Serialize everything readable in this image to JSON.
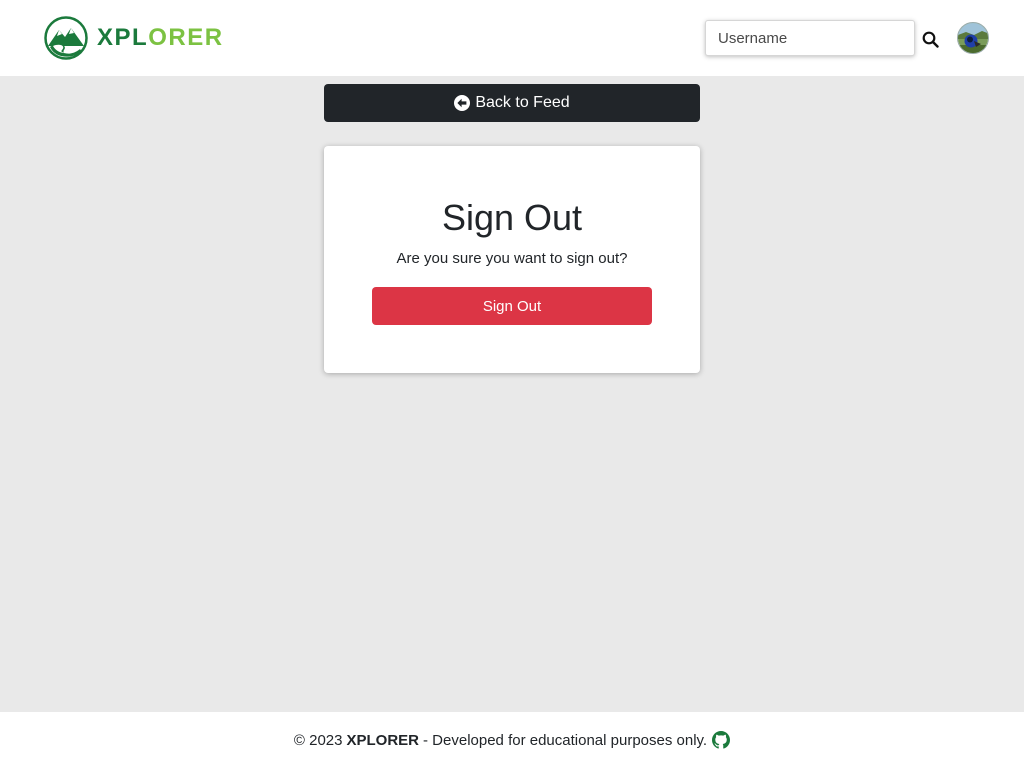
{
  "navbar": {
    "brand": {
      "part1": "XPL",
      "part2": "ORER",
      "color1": "#1b7a3c",
      "color2": "#7cc242",
      "logo_icon": "mountain-logo-icon"
    },
    "search": {
      "placeholder": "Username",
      "icon": "search-icon"
    },
    "avatar_icon": "avatar-image"
  },
  "main": {
    "back_button": {
      "label": "Back to Feed",
      "icon": "arrow-circle-left-icon"
    },
    "card": {
      "title": "Sign Out",
      "text": "Are you sure you want to sign out?",
      "button_label": "Sign Out",
      "button_color": "#dc3545"
    }
  },
  "footer": {
    "copyright": "© 2023",
    "brand": "XPLORER",
    "tagline": "- Developed for educational purposes only.",
    "icon": "github-icon",
    "icon_color": "#1b7a3c"
  }
}
